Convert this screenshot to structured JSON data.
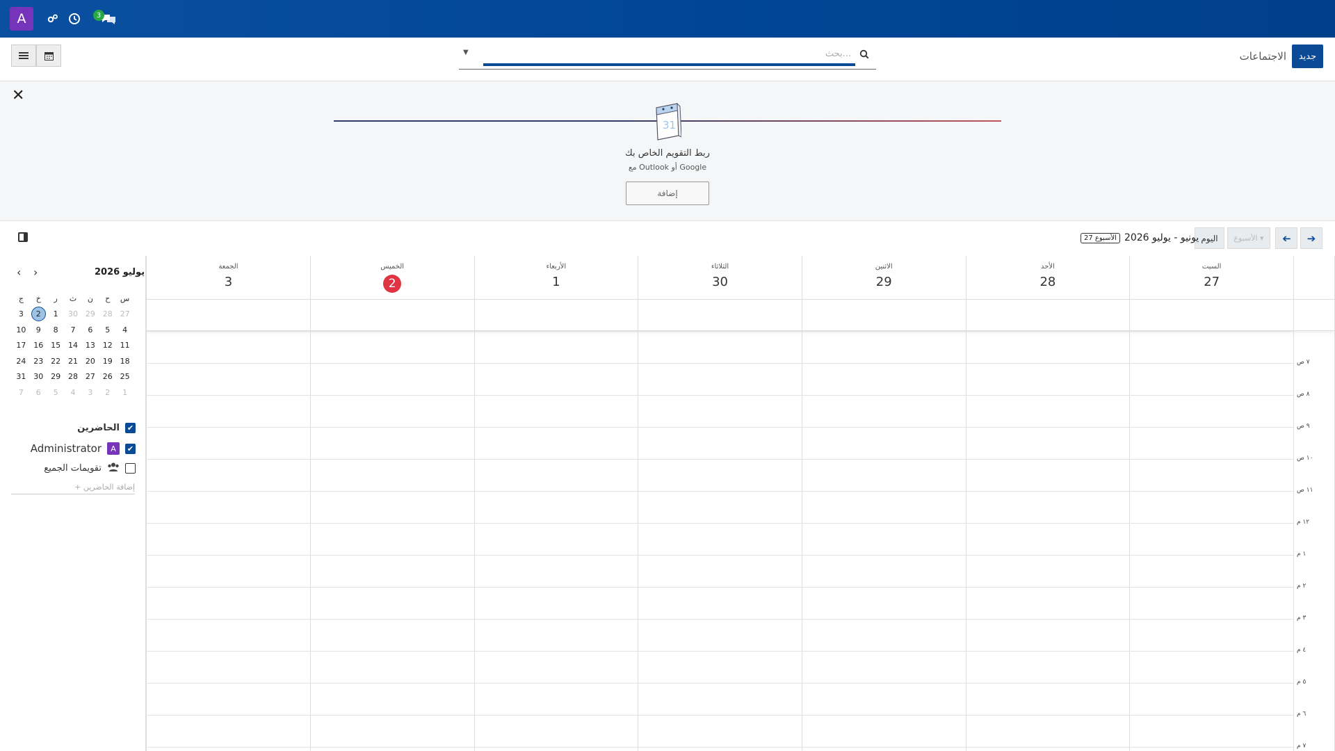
{
  "topbar": {
    "avatar_letter": "A",
    "chat_badge": "3"
  },
  "header": {
    "new_button": "جديد",
    "breadcrumb": "الاجتماعات",
    "search_placeholder": "بحث..."
  },
  "banner": {
    "title": "ربط التقويم الخاص بك",
    "subtitle": "مع Outlook أو Google",
    "add_button": "إضافة",
    "illustration_number": "31"
  },
  "calnav": {
    "today": "اليوم",
    "scale": "الأسبوع",
    "range": "يونيو - يوليو 2026",
    "week_badge": "الأسبوع 27"
  },
  "mini": {
    "month": "يوليو 2026",
    "weekdays": [
      "س",
      "ح",
      "ن",
      "ث",
      "ر",
      "خ",
      "ج"
    ],
    "weeks": [
      [
        "27",
        "28",
        "29",
        "30",
        "1",
        "2",
        "3"
      ],
      [
        "4",
        "5",
        "6",
        "7",
        "8",
        "9",
        "10"
      ],
      [
        "11",
        "12",
        "13",
        "14",
        "15",
        "16",
        "17"
      ],
      [
        "18",
        "19",
        "20",
        "21",
        "22",
        "23",
        "24"
      ],
      [
        "25",
        "26",
        "27",
        "28",
        "29",
        "30",
        "31"
      ],
      [
        "1",
        "2",
        "3",
        "4",
        "5",
        "6",
        "7"
      ]
    ]
  },
  "attendees": {
    "title": "الحاضرين",
    "me": "Administrator",
    "me_initial": "A",
    "everyone": "تقويمات الجميع",
    "add": "+ إضافة الحاضرين"
  },
  "days": [
    {
      "name": "السبت",
      "date": "27"
    },
    {
      "name": "الأحد",
      "date": "28"
    },
    {
      "name": "الاثنين",
      "date": "29"
    },
    {
      "name": "الثلاثاء",
      "date": "30"
    },
    {
      "name": "الأربعاء",
      "date": "1"
    },
    {
      "name": "الخميس",
      "date": "2"
    },
    {
      "name": "الجمعة",
      "date": "3"
    }
  ],
  "hours": [
    "٧ ص",
    "٨ ص",
    "٩ ص",
    "١٠ ص",
    "١١ ص",
    "١٢ م",
    "١ م",
    "٢ م",
    "٣ م",
    "٤ م",
    "٥ م",
    "٦ م",
    "٧ م"
  ],
  "colors": {
    "brand": "#0b4b96",
    "today": "#e03444",
    "avatar": "#7534b9"
  }
}
